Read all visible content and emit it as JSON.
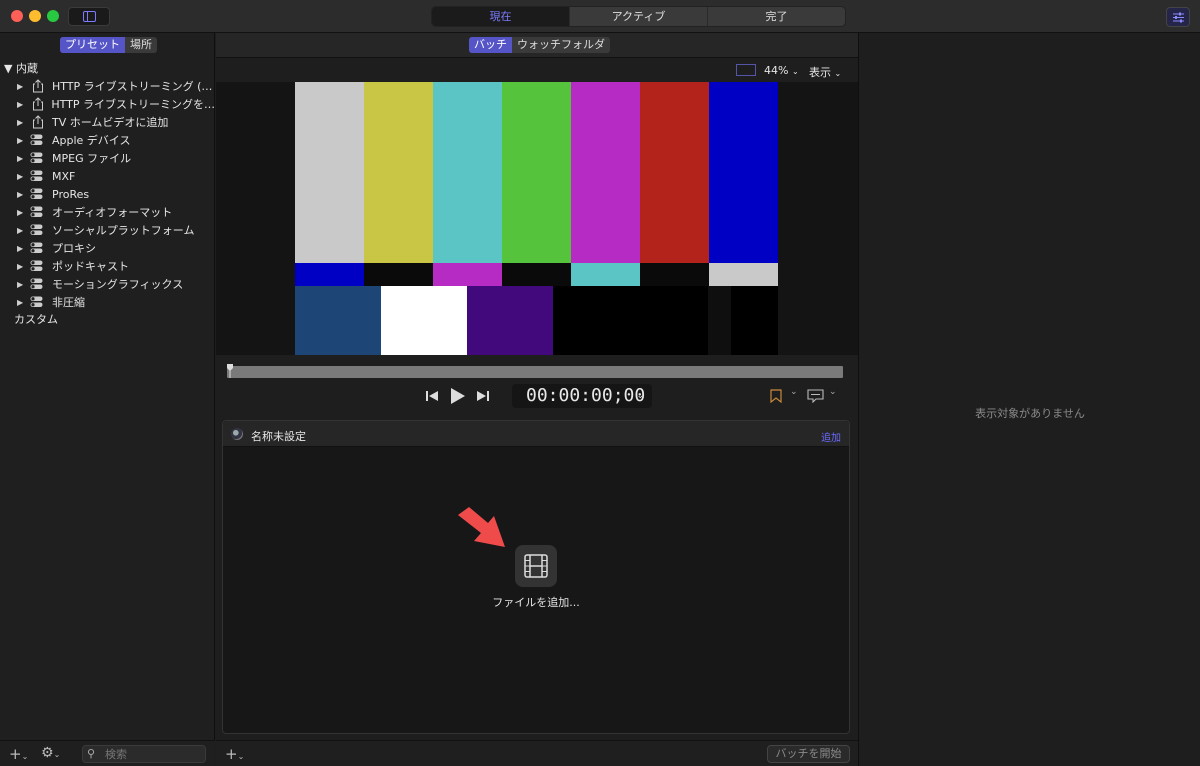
{
  "titlebar": {
    "tabs": [
      {
        "label": "現在",
        "active": true
      },
      {
        "label": "アクティブ",
        "active": false
      },
      {
        "label": "完了",
        "active": false
      }
    ]
  },
  "left": {
    "segment": [
      "プリセット",
      "場所"
    ],
    "section_header": "▼ 内蔵",
    "items": [
      {
        "label": "HTTP ライブストリーミング (…",
        "icon": "share-icon"
      },
      {
        "label": "HTTP ライブストリーミングを…",
        "icon": "share-icon"
      },
      {
        "label": "TV ホームビデオに追加",
        "icon": "share-icon"
      },
      {
        "label": "Apple デバイス",
        "icon": "toggle-group-icon"
      },
      {
        "label": "MPEG ファイル",
        "icon": "toggle-group-icon"
      },
      {
        "label": "MXF",
        "icon": "toggle-group-icon"
      },
      {
        "label": "ProRes",
        "icon": "toggle-group-icon"
      },
      {
        "label": "オーディオフォーマット",
        "icon": "toggle-group-icon"
      },
      {
        "label": "ソーシャルプラットフォーム",
        "icon": "toggle-group-icon"
      },
      {
        "label": "プロキシ",
        "icon": "toggle-group-icon"
      },
      {
        "label": "ポッドキャスト",
        "icon": "toggle-group-icon"
      },
      {
        "label": "モーショングラフィックス",
        "icon": "toggle-group-icon"
      },
      {
        "label": "非圧縮",
        "icon": "toggle-group-icon"
      }
    ],
    "custom_label": "カスタム",
    "search_placeholder": "検索"
  },
  "middle": {
    "segment": [
      "バッチ",
      "ウォッチフォルダ"
    ],
    "zoom": "44%",
    "show_menu": "表示",
    "timecode": "00:00:00;00",
    "batch": {
      "title": "名称未設定",
      "add_link": "追加",
      "add_files_label": "ファイルを追加..."
    },
    "start_batch": "バッチを開始"
  },
  "right": {
    "empty_message": "表示対象がありません"
  },
  "colors": {
    "accent": "#5555c8",
    "accent_text": "#7b7bff",
    "arrow": "#ef4b4b"
  },
  "test_pattern": {
    "top_bars": [
      "#c9c9c9",
      "#c9c646",
      "#5bc4c4",
      "#55c43c",
      "#b52bc4",
      "#b3231c",
      "#0000c4"
    ],
    "mid_bars": [
      "#0000c4",
      "#0a0a0a",
      "#b52bc4",
      "#0a0a0a",
      "#5bc4c4",
      "#0a0a0a",
      "#c9c9c9"
    ],
    "bottom_blocks": [
      "#1d4677",
      "#ffffff",
      "#42097d",
      "#000000",
      "#000000",
      "#0f0f0f",
      "#000000"
    ]
  }
}
